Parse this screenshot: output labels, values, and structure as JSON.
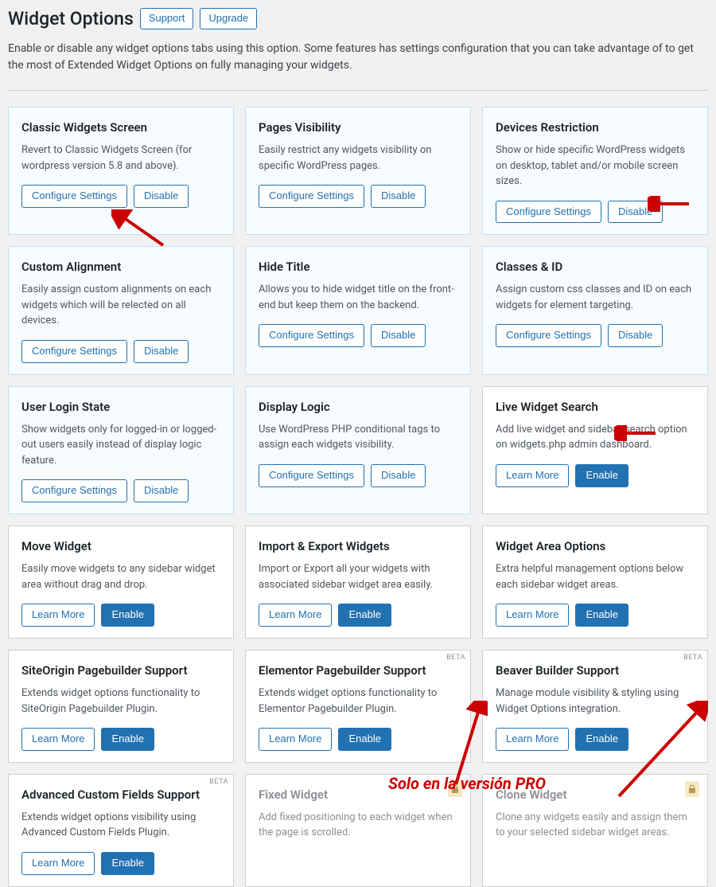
{
  "header": {
    "title": "Widget Options",
    "support": "Support",
    "upgrade": "Upgrade"
  },
  "intro": "Enable or disable any widget options tabs using this option. Some features has settings configuration that you can take advantage of to get the most of Extended Widget Options on fully managing your widgets.",
  "labels": {
    "configure": "Configure Settings",
    "disable": "Disable",
    "learn": "Learn More",
    "enable": "Enable",
    "beta": "BETA"
  },
  "pro_caption": "Solo en la versión PRO",
  "cards": [
    {
      "title": "Classic Widgets Screen",
      "desc": "Revert to Classic Widgets Screen (for wordpress version 5.8 and above).",
      "state": "active",
      "buttons": "cfg"
    },
    {
      "title": "Pages Visibility",
      "desc": "Easily restrict any widgets visibility on specific WordPress pages.",
      "state": "active",
      "buttons": "cfg"
    },
    {
      "title": "Devices Restriction",
      "desc": "Show or hide specific WordPress widgets on desktop, tablet and/or mobile screen sizes.",
      "state": "active",
      "buttons": "cfg"
    },
    {
      "title": "Custom Alignment",
      "desc": "Easily assign custom alignments on each widgets which will be relected on all devices.",
      "state": "active",
      "buttons": "cfg"
    },
    {
      "title": "Hide Title",
      "desc": "Allows you to hide widget title on the front-end but keep them on the backend.",
      "state": "active",
      "buttons": "cfg"
    },
    {
      "title": "Classes & ID",
      "desc": "Assign custom css classes and ID on each widgets for element targeting.",
      "state": "active",
      "buttons": "cfg"
    },
    {
      "title": "User Login State",
      "desc": "Show widgets only for logged-in or logged-out users easily instead of display logic feature.",
      "state": "active",
      "buttons": "cfg"
    },
    {
      "title": "Display Logic",
      "desc": "Use WordPress PHP conditional tags to assign each widgets visibility.",
      "state": "active",
      "buttons": "cfg"
    },
    {
      "title": "Live Widget Search",
      "desc": "Add live widget and sidebar search option on widgets.php admin dashboard.",
      "state": "plain",
      "buttons": "learn"
    },
    {
      "title": "Move Widget",
      "desc": "Easily move widgets to any sidebar widget area without drag and drop.",
      "state": "plain",
      "buttons": "learn"
    },
    {
      "title": "Import & Export Widgets",
      "desc": "Import or Export all your widgets with associated sidebar widget area easily.",
      "state": "plain",
      "buttons": "learn"
    },
    {
      "title": "Widget Area Options",
      "desc": "Extra helpful management options below each sidebar widget areas.",
      "state": "plain",
      "buttons": "learn"
    },
    {
      "title": "SiteOrigin Pagebuilder Support",
      "desc": "Extends widget options functionality to SiteOrigin Pagebuilder Plugin.",
      "state": "plain",
      "buttons": "learn"
    },
    {
      "title": "Elementor Pagebuilder Support",
      "desc": "Extends widget options functionality to Elementor Pagebuilder Plugin.",
      "state": "plain",
      "buttons": "learn",
      "beta": true
    },
    {
      "title": "Beaver Builder Support",
      "desc": "Manage module visibility & styling using Widget Options integration.",
      "state": "plain",
      "buttons": "learn",
      "beta": true
    },
    {
      "title": "Advanced Custom Fields Support",
      "desc": "Extends widget options visibility using Advanced Custom Fields Plugin.",
      "state": "plain",
      "buttons": "learn",
      "beta": true
    },
    {
      "title": "Fixed Widget",
      "desc": "Add fixed positioning to each widget when the page is scrolled.",
      "state": "locked",
      "buttons": "none",
      "lock": true
    },
    {
      "title": "Clone Widget",
      "desc": "Clone any widgets easily and assign them to your selected sidebar widget areas.",
      "state": "locked",
      "buttons": "none",
      "lock": true
    }
  ]
}
